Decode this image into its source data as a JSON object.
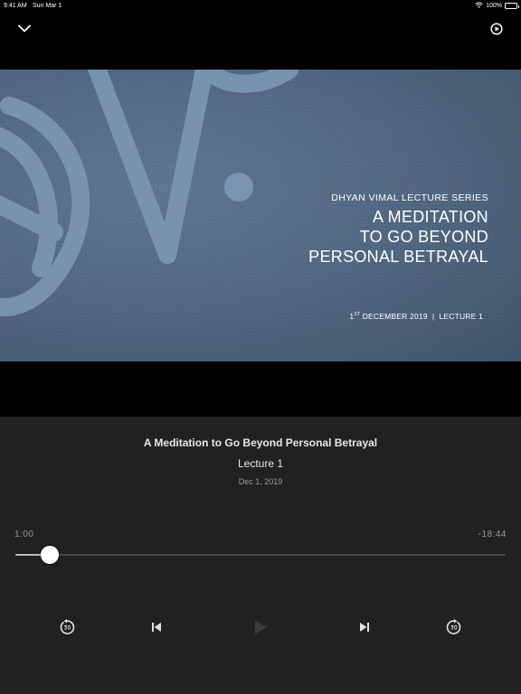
{
  "status_bar": {
    "time": "9:41 AM",
    "date": "Sun Mar 1",
    "battery": "100%"
  },
  "artwork": {
    "series": "DHYAN VIMAL LECTURE SERIES",
    "title_lines": [
      "A MEDITATION",
      "TO GO BEYOND",
      "PERSONAL BETRAYAL"
    ],
    "date_day": "1",
    "date_suffix": "ST",
    "date_rest": "DECEMBER 2019",
    "separator": "|",
    "lecture": "LECTURE 1"
  },
  "now_playing": {
    "title": "A Meditation to Go Beyond Personal Betrayal",
    "subtitle": "Lecture 1",
    "date": "Dec 1, 2019"
  },
  "progress": {
    "elapsed": "1:00",
    "remaining": "-18:44",
    "fraction": 0.07
  },
  "icons": {
    "collapse": "chevron-down-icon",
    "airplay": "airplay-icon",
    "rewind": "rewind-30-icon",
    "previous": "skip-previous-icon",
    "play": "play-icon",
    "next": "skip-next-icon",
    "forward": "forward-30-icon"
  },
  "colors": {
    "panel": "#212121",
    "artwork": "#50667e",
    "accent": "#ffffff",
    "secondary_text": "#9a9a9a"
  }
}
